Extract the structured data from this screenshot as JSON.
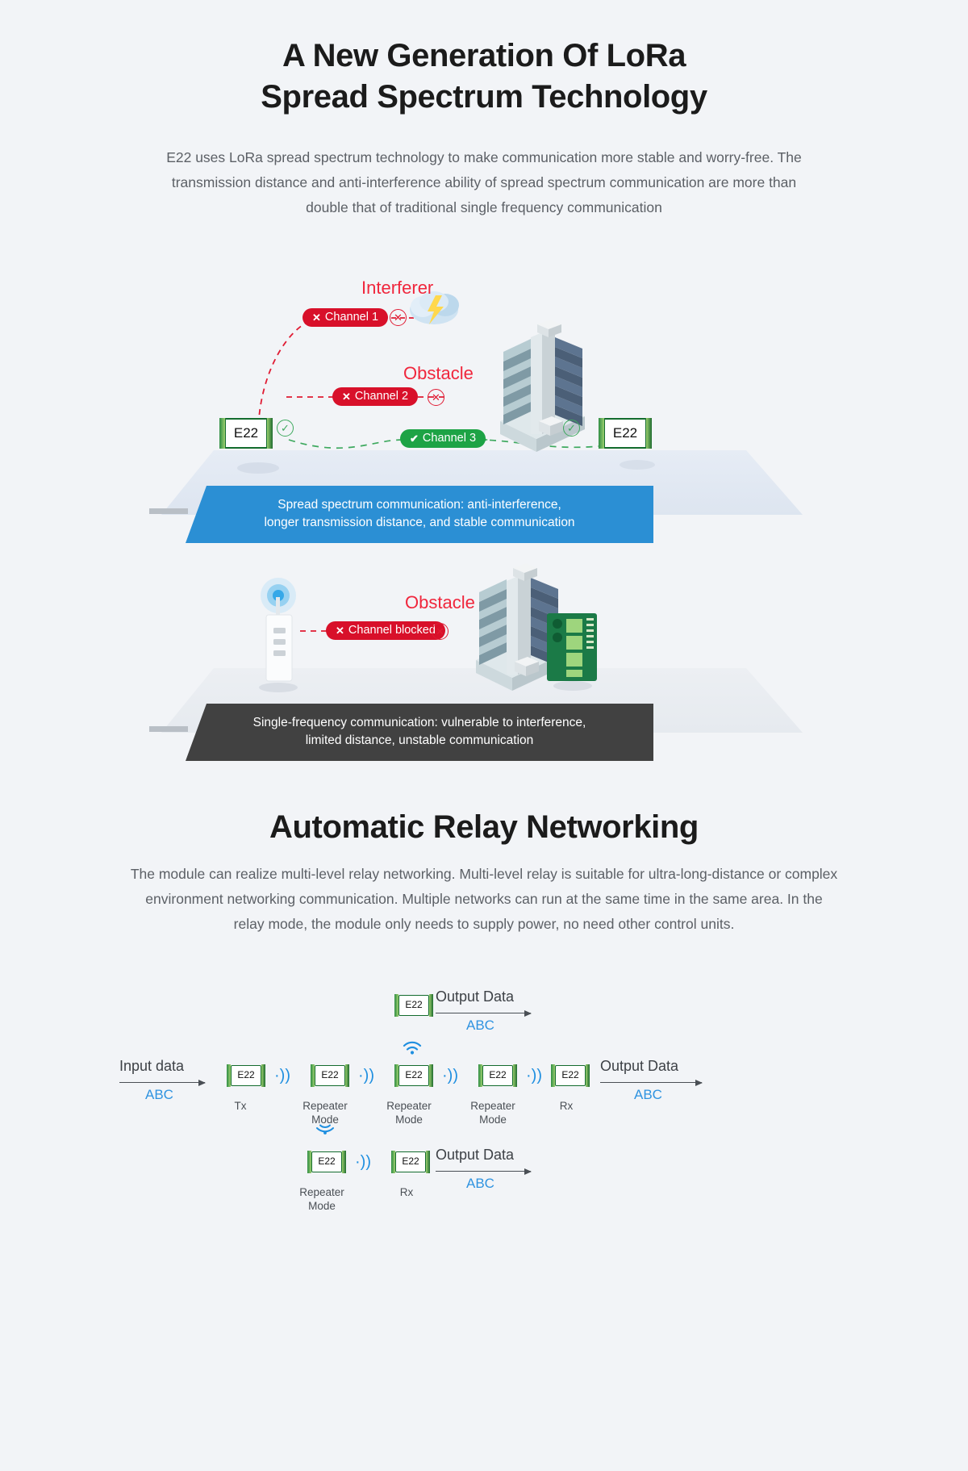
{
  "section1": {
    "title_line1": "A New Generation Of LoRa",
    "title_line2": "Spread Spectrum Technology",
    "paragraph": "E22 uses LoRa spread spectrum technology to make communication more stable and worry-free. The transmission distance and anti-interference ability of spread spectrum communication are more than double that of traditional single frequency communication",
    "diagram_spread": {
      "interferer_label": "Interferer",
      "obstacle_label": "Obstacle",
      "channel1": "Channel 1",
      "channel2": "Channel 2",
      "channel3": "Channel 3",
      "module_left": "E22",
      "module_right": "E22",
      "fail_mark": "✕",
      "ok_mark": "✔",
      "banner": "Spread spectrum communication: anti-interference,\nlonger transmission distance, and stable communication",
      "banner_color": "#2b8fd4"
    },
    "diagram_single": {
      "obstacle_label": "Obstacle",
      "channel_blocked": "Channel blocked",
      "fail_mark": "✕",
      "banner": "Single-frequency communication: vulnerable to interference,\nlimited distance, unstable communication",
      "banner_color": "#414141"
    }
  },
  "section2": {
    "title": "Automatic Relay Networking",
    "paragraph": "The module can realize multi-level relay networking. Multi-level relay is suitable for ultra-long-distance or complex environment networking communication. Multiple networks can run at the same time in the same area. In the relay mode, the module only needs to supply power, no need other control units.",
    "relay_diagram": {
      "input_label": "Input data",
      "input_value": "ABC",
      "module_label": "E22",
      "main_chain": [
        {
          "label": "Tx"
        },
        {
          "label": "Repeater\nMode"
        },
        {
          "label": "Repeater\nMode"
        },
        {
          "label": "Repeater\nMode"
        },
        {
          "label": "Rx"
        }
      ],
      "main_output_label": "Output Data",
      "main_output_value": "ABC",
      "top_branch": {
        "output_label": "Output Data",
        "output_value": "ABC"
      },
      "bottom_branch": {
        "repeater_label": "Repeater\nMode",
        "rx_label": "Rx",
        "output_label": "Output Data",
        "output_value": "ABC"
      }
    }
  },
  "colors": {
    "background": "#f2f4f7",
    "accent_blue": "#2b8fd4",
    "danger_red": "#d8102a",
    "success_green": "#1da345",
    "data_blue": "#2f93e0",
    "dark_banner": "#414141"
  }
}
